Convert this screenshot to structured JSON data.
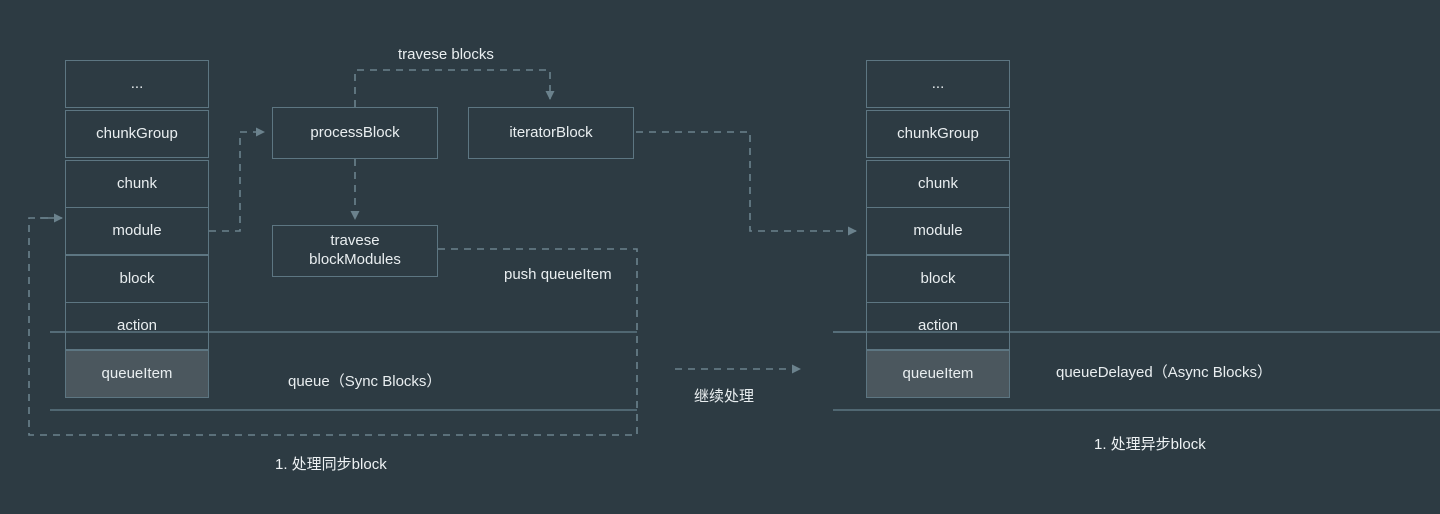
{
  "diagram": {
    "title_sync": "1. 处理同步block",
    "title_async": "1. 处理异步block",
    "background_color": "#2d3b43",
    "line_color": "#6b828d",
    "box_border_color": "#5d7682",
    "highlight_color": "#4b575e",
    "text_color": "#e9eef0"
  },
  "sync_stack": {
    "name": "queue stack",
    "cells": [
      {
        "label": "...",
        "highlighted": false
      },
      {
        "label": "chunkGroup",
        "highlighted": false
      },
      {
        "label": "chunk",
        "highlighted": false
      },
      {
        "label": "module",
        "highlighted": false
      },
      {
        "label": "block",
        "highlighted": false
      },
      {
        "label": "action",
        "highlighted": false
      },
      {
        "label": "queueItem",
        "highlighted": true
      }
    ]
  },
  "async_stack": {
    "name": "queueDelayed stack",
    "cells": [
      {
        "label": "...",
        "highlighted": false
      },
      {
        "label": "chunkGroup",
        "highlighted": false
      },
      {
        "label": "chunk",
        "highlighted": false
      },
      {
        "label": "module",
        "highlighted": false
      },
      {
        "label": "block",
        "highlighted": false
      },
      {
        "label": "action",
        "highlighted": false
      },
      {
        "label": "queueItem",
        "highlighted": true
      }
    ]
  },
  "nodes": {
    "process_block": "processBlock",
    "iterator_block": "iteratorBlock",
    "travese_block_modules_line1": "travese",
    "travese_block_modules_line2": "blockModules"
  },
  "edge_labels": {
    "travese_blocks": "travese blocks",
    "push_queue_item": "push queueItem",
    "continue_process": "继续处理"
  },
  "band_labels": {
    "queue_sync": "queue（Sync Blocks）",
    "queue_delayed_async": "queueDelayed（Async Blocks）"
  }
}
